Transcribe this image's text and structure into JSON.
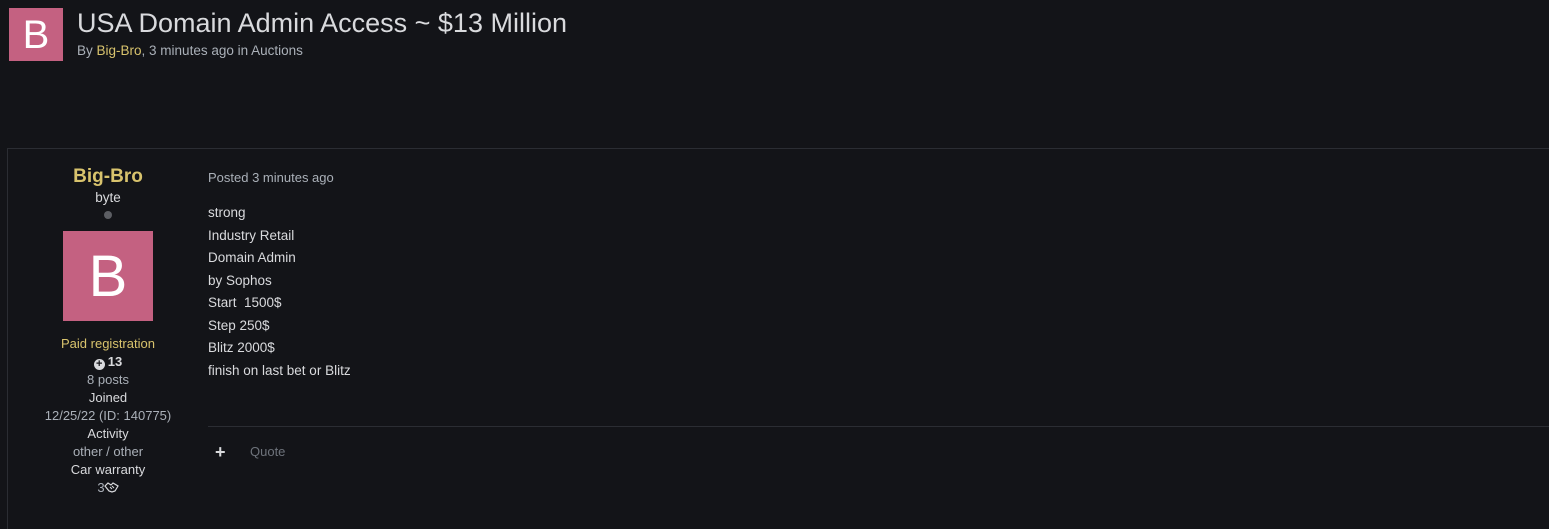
{
  "topic": {
    "avatar_letter": "B",
    "title": "USA Domain Admin Access ~ $13 Million",
    "by_label": "By",
    "author": "Big-Bro",
    "time_sep": ", 3 minutes ago in",
    "forum": "Auctions"
  },
  "author": {
    "name": "Big-Bro",
    "rank": "byte",
    "avatar_letter": "B",
    "group": "Paid registration",
    "reputation": "13",
    "posts": "8 posts",
    "joined_label": "Joined",
    "joined_value": "12/25/22 (ID: 140775)",
    "activity_label": "Activity",
    "activity_value": "other / other",
    "warranty_label": "Car warranty",
    "warranty_value": "3"
  },
  "post": {
    "date": "Posted 3 minutes ago",
    "lines": [
      "strong",
      "Industry Retail",
      "Domain Admin",
      "by Sophos",
      "Start  1500$",
      "Step 250$",
      "Blitz 2000$",
      "finish on last bet or Blitz"
    ],
    "quote_label": "Quote",
    "plus_label": "+"
  },
  "icons": {
    "online_status": "online-dot-icon",
    "reputation": "plus-circle-icon",
    "warranty": "handshake-icon"
  },
  "colors": {
    "background": "#131418",
    "avatar": "#c46181",
    "author_name": "#d8c36d",
    "muted": "#aab0b8"
  }
}
